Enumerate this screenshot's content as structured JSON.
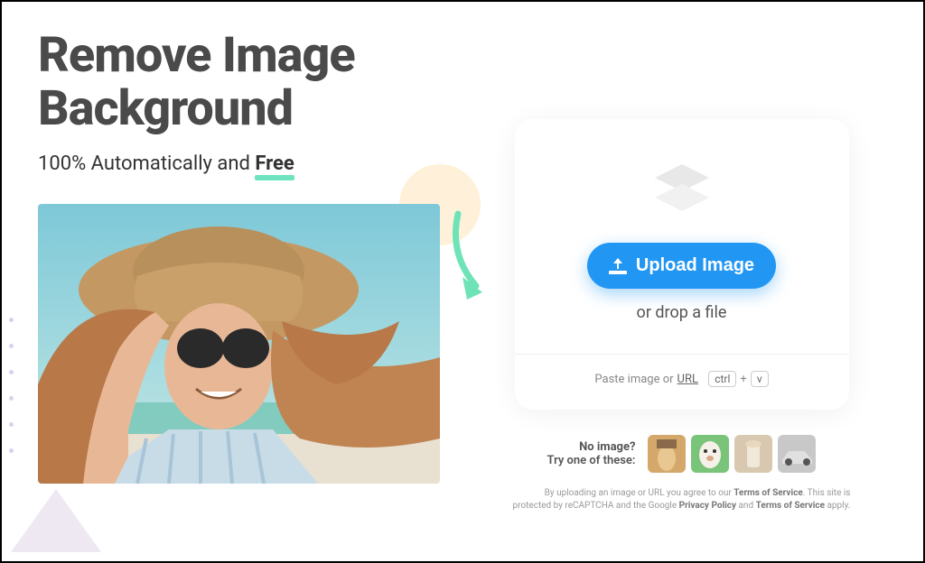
{
  "hero": {
    "headline_line1": "Remove Image",
    "headline_line2": "Background",
    "subhead_prefix": "100% Automatically and ",
    "subhead_free": "Free"
  },
  "upload": {
    "button_label": "Upload Image",
    "drop_text": "or drop a file",
    "paste_prefix": "Paste image or ",
    "paste_url": "URL",
    "key1": "ctrl",
    "key_plus": "+",
    "key2": "v"
  },
  "samples": {
    "no_image": "No image?",
    "try_one": "Try one of these:"
  },
  "legal": {
    "line1_prefix": "By uploading an image or URL you agree to our ",
    "terms": "Terms of Service",
    "line1_suffix": ". This site is",
    "line2_prefix": "protected by reCAPTCHA and the Google ",
    "privacy": "Privacy Policy",
    "and": " and ",
    "terms2": "Terms of Service",
    "apply": " apply."
  }
}
